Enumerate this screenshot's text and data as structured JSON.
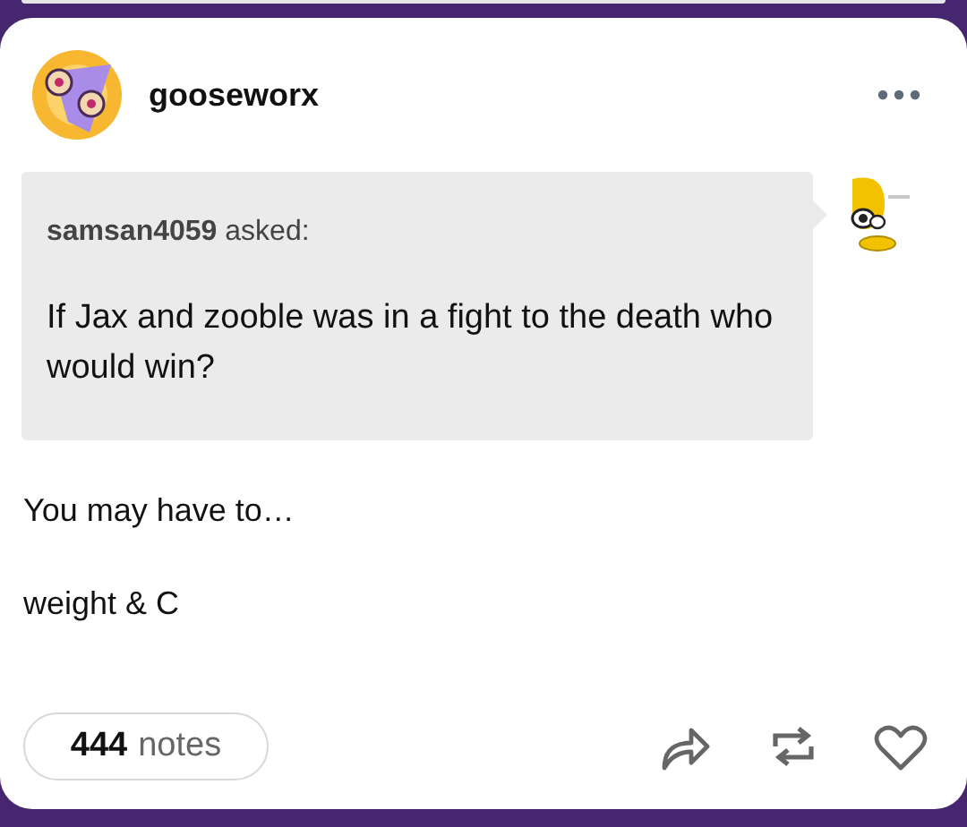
{
  "post": {
    "blog_name": "gooseworx",
    "ask": {
      "asker": "samsan4059",
      "asked_label": "asked:",
      "question": "If Jax and zooble was in a fight to the death who would win?"
    },
    "paragraphs": [
      "You may have to…",
      "weight & C"
    ],
    "notes": {
      "count": "444",
      "label": "notes"
    }
  }
}
